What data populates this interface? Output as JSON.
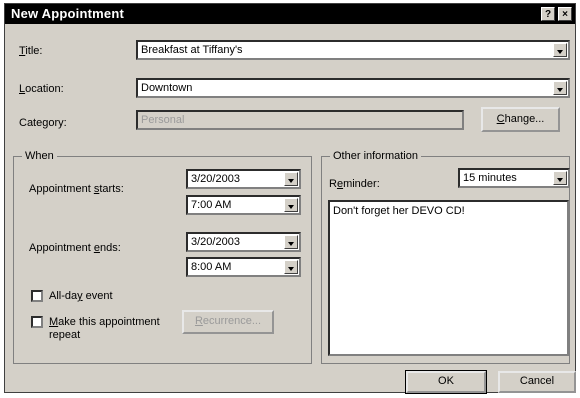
{
  "window": {
    "title": "New Appointment",
    "help_glyph": "?",
    "close_glyph": "×"
  },
  "title_field": {
    "label": "Title:",
    "value": "Breakfast at Tiffany's"
  },
  "location_field": {
    "label": "Location:",
    "value": "Downtown"
  },
  "category_field": {
    "label": "Category:",
    "value": "Personal",
    "change_button": "Change..."
  },
  "when": {
    "group_label": "When",
    "starts_label": "Appointment starts:",
    "start_date": "3/20/2003",
    "start_time": "7:00 AM",
    "ends_label": "Appointment ends:",
    "end_date": "3/20/2003",
    "end_time": "8:00 AM",
    "all_day_label": "All-day event",
    "repeat_label": "Make this appointment repeat",
    "recurrence_button": "Recurrence..."
  },
  "other": {
    "group_label": "Other information",
    "reminder_label": "Reminder:",
    "reminder_value": "15 minutes",
    "notes": "Don't forget her DEVO CD!"
  },
  "buttons": {
    "ok": "OK",
    "cancel": "Cancel"
  }
}
